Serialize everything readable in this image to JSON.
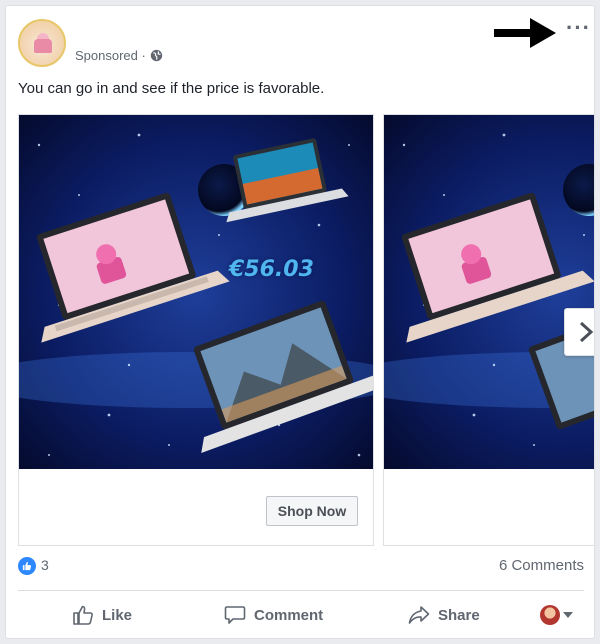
{
  "post": {
    "sponsored_label": "Sponsored · ",
    "text": "You can go in and see if the price is favorable.",
    "more_icon": "more-options-icon",
    "annotation_icon": "arrow-right-icon"
  },
  "carousel": {
    "cards": [
      {
        "price": "€56.03",
        "cta": "Shop Now"
      },
      {
        "price": "",
        "cta": ""
      }
    ],
    "next_icon": "chevron-right-icon"
  },
  "stats": {
    "likes": "3",
    "comments": "6 Comments"
  },
  "actions": {
    "like": "Like",
    "comment": "Comment",
    "share": "Share"
  },
  "colors": {
    "accent": "#2d88ff",
    "muted_text": "#606770",
    "price": "#4fb6f0"
  }
}
